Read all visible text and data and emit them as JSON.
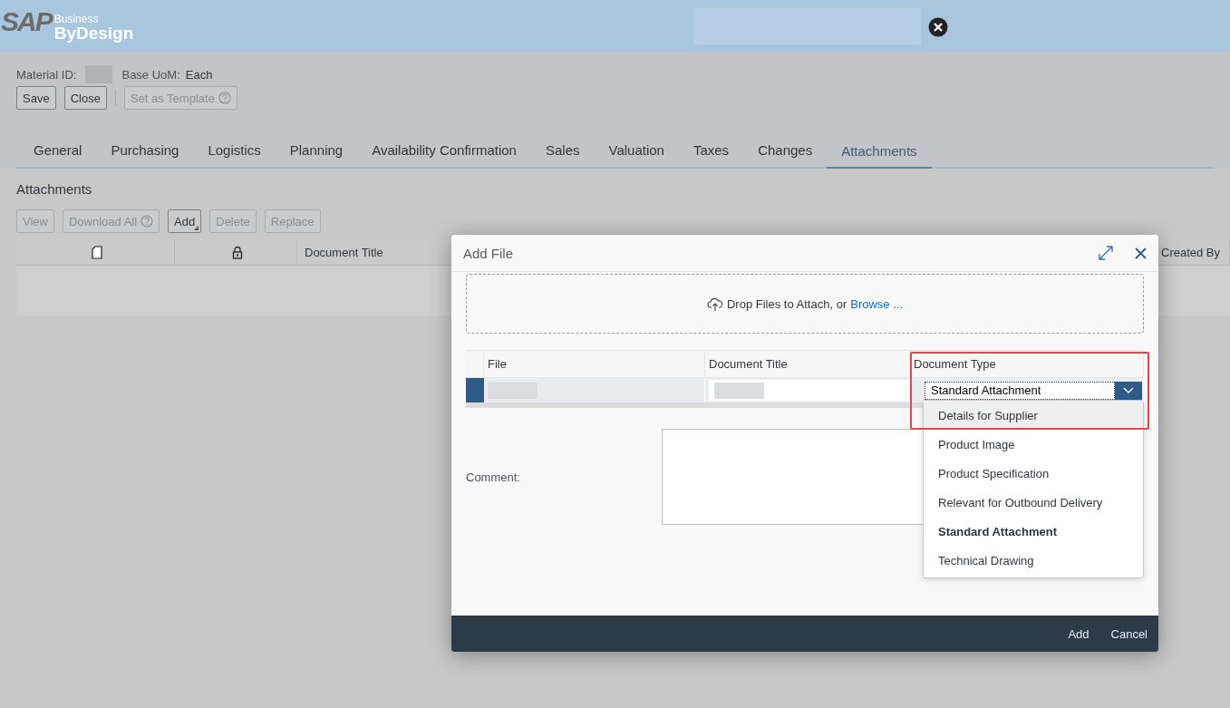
{
  "header": {
    "brand": "SAP",
    "brand_line1": "Business",
    "brand_line2": "ByDesign"
  },
  "object_header": {
    "fields": [
      {
        "label": "Material ID:",
        "redacted": true
      },
      {
        "label": "Base UoM:",
        "redacted": false,
        "value": "Each"
      }
    ],
    "buttons": [
      {
        "label": "Save",
        "disabled": false,
        "help": false
      },
      {
        "label": "Close",
        "disabled": false,
        "help": false
      },
      {
        "label": "Set as Template",
        "disabled": true,
        "help": true
      }
    ]
  },
  "tabs": [
    {
      "label": "General",
      "selected": false
    },
    {
      "label": "Purchasing",
      "selected": false
    },
    {
      "label": "Logistics",
      "selected": false
    },
    {
      "label": "Planning",
      "selected": false
    },
    {
      "label": "Availability Confirmation",
      "selected": false
    },
    {
      "label": "Sales",
      "selected": false
    },
    {
      "label": "Valuation",
      "selected": false
    },
    {
      "label": "Taxes",
      "selected": false
    },
    {
      "label": "Changes",
      "selected": false
    },
    {
      "label": "Attachments",
      "selected": true
    }
  ],
  "section": {
    "title": "Attachments",
    "toolbar": [
      {
        "label": "View",
        "disabled": true,
        "help": false,
        "menu": false
      },
      {
        "label": "Download All",
        "disabled": true,
        "help": true,
        "menu": false
      },
      {
        "label": "Add",
        "disabled": false,
        "help": false,
        "menu": true
      },
      {
        "label": "Delete",
        "disabled": true,
        "help": false,
        "menu": false
      },
      {
        "label": "Replace",
        "disabled": true,
        "help": false,
        "menu": false
      }
    ],
    "columns": [
      {
        "kind": "file-icon"
      },
      {
        "kind": "lock-icon"
      },
      {
        "kind": "text",
        "label": "Document Title"
      },
      {
        "kind": "text",
        "label": "Created By"
      }
    ]
  },
  "dialog": {
    "title": "Add File",
    "drop_text": "Drop Files to Attach, or",
    "browse_link": "Browse ...",
    "columns": [
      "File",
      "Document Title",
      "Document Type"
    ],
    "row": {
      "selected": true,
      "document_type": "Standard Attachment"
    },
    "comment_label": "Comment:",
    "options": [
      {
        "label": "Details for Supplier",
        "selected": false,
        "highlighted": true
      },
      {
        "label": "Product Image",
        "selected": false,
        "highlighted": false
      },
      {
        "label": "Product Specification",
        "selected": false,
        "highlighted": false
      },
      {
        "label": "Relevant for Outbound Delivery",
        "selected": false,
        "highlighted": false
      },
      {
        "label": "Standard Attachment",
        "selected": true,
        "highlighted": false
      },
      {
        "label": "Technical Drawing",
        "selected": false,
        "highlighted": false
      }
    ],
    "footer_buttons": [
      "Add",
      "Cancel"
    ]
  }
}
